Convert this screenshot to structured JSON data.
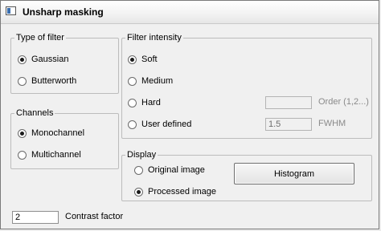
{
  "window": {
    "title": "Unsharp masking",
    "icon": "window-icon"
  },
  "filter_type": {
    "legend": "Type of filter",
    "options": [
      {
        "label": "Gaussian",
        "checked": true
      },
      {
        "label": "Butterworth",
        "checked": false
      }
    ]
  },
  "channels": {
    "legend": "Channels",
    "options": [
      {
        "label": "Monochannel",
        "checked": true
      },
      {
        "label": "Multichannel",
        "checked": false
      }
    ]
  },
  "filter_intensity": {
    "legend": "Filter intensity",
    "options": [
      {
        "label": "Soft",
        "checked": true
      },
      {
        "label": "Medium",
        "checked": false
      },
      {
        "label": "Hard",
        "checked": false
      },
      {
        "label": "User defined",
        "checked": false
      }
    ],
    "order_value": "",
    "order_label": "Order (1,2...)",
    "fwhm_value": "1.5",
    "fwhm_label": "FWHM"
  },
  "display": {
    "legend": "Display",
    "options": [
      {
        "label": "Original image",
        "checked": false
      },
      {
        "label": "Processed image",
        "checked": true
      }
    ],
    "histogram_label": "Histogram"
  },
  "contrast": {
    "value": "2",
    "label": "Contrast factor"
  }
}
